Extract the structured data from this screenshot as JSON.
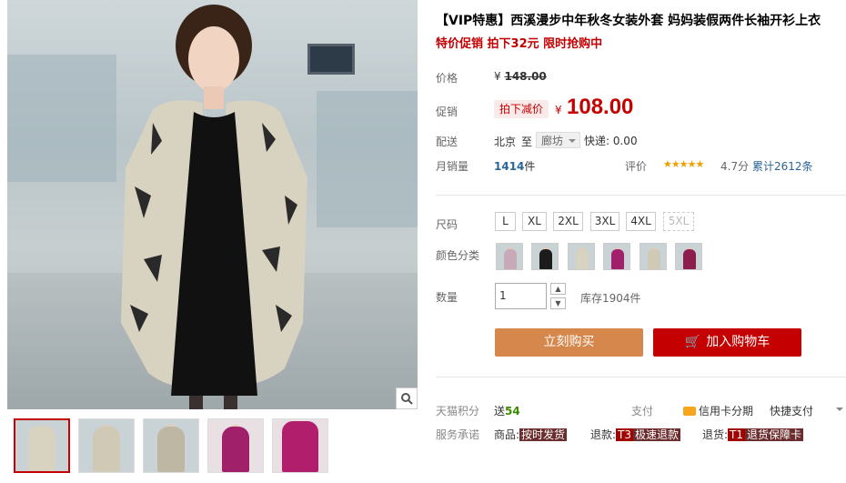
{
  "product": {
    "title": "【VIP特惠】西溪漫步中年秋冬女装外套 妈妈装假两件长袖开衫上衣",
    "subtitle": "特价促销 拍下32元 限时抢购中"
  },
  "price": {
    "label": "价格",
    "currency": "¥",
    "original": "148.00"
  },
  "promo": {
    "label": "促销",
    "tag": "拍下减价",
    "currency": "¥",
    "price": "108.00"
  },
  "delivery": {
    "label": "配送",
    "from": "北京",
    "to_text": "至",
    "destination": "廊坊",
    "fee": "快递: 0.00"
  },
  "sales": {
    "label": "月销量",
    "count": "1414",
    "unit": "件",
    "rating_label": "评价",
    "stars": "★★★★★",
    "score": "4.7分",
    "total": "累计2612条"
  },
  "size": {
    "label": "尺码",
    "options": [
      "L",
      "XL",
      "2XL",
      "3XL",
      "4XL",
      "5XL"
    ]
  },
  "color": {
    "label": "颜色分类"
  },
  "quantity": {
    "label": "数量",
    "value": "1",
    "stock": "库存1904件",
    "up": "▲",
    "down": "▼"
  },
  "actions": {
    "buy": "立刻购买",
    "cart": "加入购物车",
    "cart_icon": "🛒"
  },
  "points": {
    "label": "天猫积分",
    "prefix": "送",
    "value": "54",
    "pay_label": "支付",
    "credit": "信用卡分期",
    "quick_pay": "快捷支付"
  },
  "service": {
    "label": "服务承诺",
    "item1_prefix": "商品:",
    "item1": "按时发货",
    "item2_prefix": "退款:",
    "item2_code": "T3",
    "item2": "极速退款",
    "item3_prefix": "退货:",
    "item3_code": "T1",
    "item3": "退货保障卡"
  },
  "colors": {
    "accent": "#c40000",
    "buy": "#d6874b"
  }
}
